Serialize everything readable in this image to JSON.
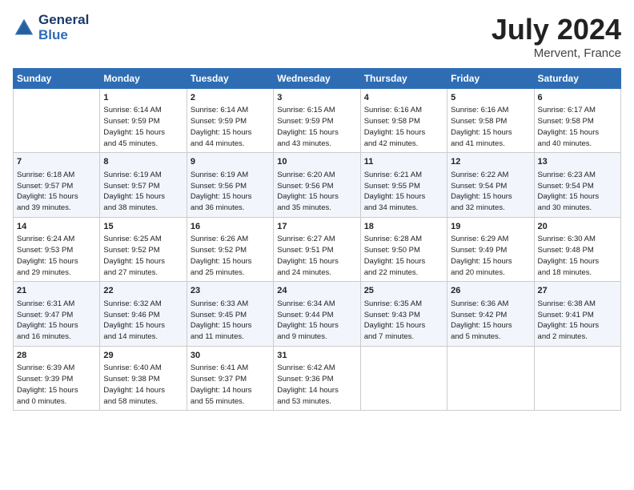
{
  "header": {
    "logo_line1": "General",
    "logo_line2": "Blue",
    "month": "July 2024",
    "location": "Mervent, France"
  },
  "columns": [
    "Sunday",
    "Monday",
    "Tuesday",
    "Wednesday",
    "Thursday",
    "Friday",
    "Saturday"
  ],
  "weeks": [
    [
      {
        "day": "",
        "info": ""
      },
      {
        "day": "1",
        "info": "Sunrise: 6:14 AM\nSunset: 9:59 PM\nDaylight: 15 hours\nand 45 minutes."
      },
      {
        "day": "2",
        "info": "Sunrise: 6:14 AM\nSunset: 9:59 PM\nDaylight: 15 hours\nand 44 minutes."
      },
      {
        "day": "3",
        "info": "Sunrise: 6:15 AM\nSunset: 9:59 PM\nDaylight: 15 hours\nand 43 minutes."
      },
      {
        "day": "4",
        "info": "Sunrise: 6:16 AM\nSunset: 9:58 PM\nDaylight: 15 hours\nand 42 minutes."
      },
      {
        "day": "5",
        "info": "Sunrise: 6:16 AM\nSunset: 9:58 PM\nDaylight: 15 hours\nand 41 minutes."
      },
      {
        "day": "6",
        "info": "Sunrise: 6:17 AM\nSunset: 9:58 PM\nDaylight: 15 hours\nand 40 minutes."
      }
    ],
    [
      {
        "day": "7",
        "info": "Sunrise: 6:18 AM\nSunset: 9:57 PM\nDaylight: 15 hours\nand 39 minutes."
      },
      {
        "day": "8",
        "info": "Sunrise: 6:19 AM\nSunset: 9:57 PM\nDaylight: 15 hours\nand 38 minutes."
      },
      {
        "day": "9",
        "info": "Sunrise: 6:19 AM\nSunset: 9:56 PM\nDaylight: 15 hours\nand 36 minutes."
      },
      {
        "day": "10",
        "info": "Sunrise: 6:20 AM\nSunset: 9:56 PM\nDaylight: 15 hours\nand 35 minutes."
      },
      {
        "day": "11",
        "info": "Sunrise: 6:21 AM\nSunset: 9:55 PM\nDaylight: 15 hours\nand 34 minutes."
      },
      {
        "day": "12",
        "info": "Sunrise: 6:22 AM\nSunset: 9:54 PM\nDaylight: 15 hours\nand 32 minutes."
      },
      {
        "day": "13",
        "info": "Sunrise: 6:23 AM\nSunset: 9:54 PM\nDaylight: 15 hours\nand 30 minutes."
      }
    ],
    [
      {
        "day": "14",
        "info": "Sunrise: 6:24 AM\nSunset: 9:53 PM\nDaylight: 15 hours\nand 29 minutes."
      },
      {
        "day": "15",
        "info": "Sunrise: 6:25 AM\nSunset: 9:52 PM\nDaylight: 15 hours\nand 27 minutes."
      },
      {
        "day": "16",
        "info": "Sunrise: 6:26 AM\nSunset: 9:52 PM\nDaylight: 15 hours\nand 25 minutes."
      },
      {
        "day": "17",
        "info": "Sunrise: 6:27 AM\nSunset: 9:51 PM\nDaylight: 15 hours\nand 24 minutes."
      },
      {
        "day": "18",
        "info": "Sunrise: 6:28 AM\nSunset: 9:50 PM\nDaylight: 15 hours\nand 22 minutes."
      },
      {
        "day": "19",
        "info": "Sunrise: 6:29 AM\nSunset: 9:49 PM\nDaylight: 15 hours\nand 20 minutes."
      },
      {
        "day": "20",
        "info": "Sunrise: 6:30 AM\nSunset: 9:48 PM\nDaylight: 15 hours\nand 18 minutes."
      }
    ],
    [
      {
        "day": "21",
        "info": "Sunrise: 6:31 AM\nSunset: 9:47 PM\nDaylight: 15 hours\nand 16 minutes."
      },
      {
        "day": "22",
        "info": "Sunrise: 6:32 AM\nSunset: 9:46 PM\nDaylight: 15 hours\nand 14 minutes."
      },
      {
        "day": "23",
        "info": "Sunrise: 6:33 AM\nSunset: 9:45 PM\nDaylight: 15 hours\nand 11 minutes."
      },
      {
        "day": "24",
        "info": "Sunrise: 6:34 AM\nSunset: 9:44 PM\nDaylight: 15 hours\nand 9 minutes."
      },
      {
        "day": "25",
        "info": "Sunrise: 6:35 AM\nSunset: 9:43 PM\nDaylight: 15 hours\nand 7 minutes."
      },
      {
        "day": "26",
        "info": "Sunrise: 6:36 AM\nSunset: 9:42 PM\nDaylight: 15 hours\nand 5 minutes."
      },
      {
        "day": "27",
        "info": "Sunrise: 6:38 AM\nSunset: 9:41 PM\nDaylight: 15 hours\nand 2 minutes."
      }
    ],
    [
      {
        "day": "28",
        "info": "Sunrise: 6:39 AM\nSunset: 9:39 PM\nDaylight: 15 hours\nand 0 minutes."
      },
      {
        "day": "29",
        "info": "Sunrise: 6:40 AM\nSunset: 9:38 PM\nDaylight: 14 hours\nand 58 minutes."
      },
      {
        "day": "30",
        "info": "Sunrise: 6:41 AM\nSunset: 9:37 PM\nDaylight: 14 hours\nand 55 minutes."
      },
      {
        "day": "31",
        "info": "Sunrise: 6:42 AM\nSunset: 9:36 PM\nDaylight: 14 hours\nand 53 minutes."
      },
      {
        "day": "",
        "info": ""
      },
      {
        "day": "",
        "info": ""
      },
      {
        "day": "",
        "info": ""
      }
    ]
  ]
}
